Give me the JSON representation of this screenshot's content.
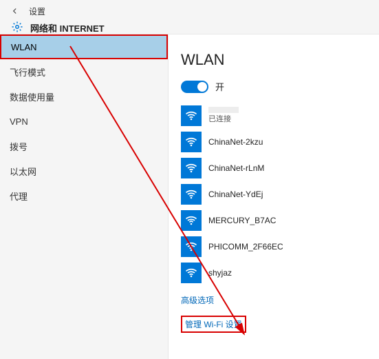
{
  "header": {
    "settings_label": "设置",
    "category": "网络和 INTERNET"
  },
  "sidebar": {
    "items": [
      {
        "label": "WLAN",
        "selected": true,
        "highlighted": true
      },
      {
        "label": "飞行模式"
      },
      {
        "label": "数据使用量"
      },
      {
        "label": "VPN"
      },
      {
        "label": "拨号"
      },
      {
        "label": "以太网"
      },
      {
        "label": "代理"
      }
    ]
  },
  "main": {
    "title": "WLAN",
    "toggle": {
      "on": true,
      "label": "开"
    },
    "networks": [
      {
        "name": "",
        "status": "已连接",
        "connected": true
      },
      {
        "name": "ChinaNet-2kzu"
      },
      {
        "name": "ChinaNet-rLnM"
      },
      {
        "name": "ChinaNet-YdEj"
      },
      {
        "name": "MERCURY_B7AC"
      },
      {
        "name": "PHICOMM_2F66EC"
      },
      {
        "name": "shyjaz"
      }
    ],
    "advanced_link": "高级选项",
    "manage_link": "管理 Wi-Fi 设置"
  },
  "colors": {
    "accent": "#0078d7",
    "highlight": "#d80000",
    "link": "#0067b8"
  }
}
